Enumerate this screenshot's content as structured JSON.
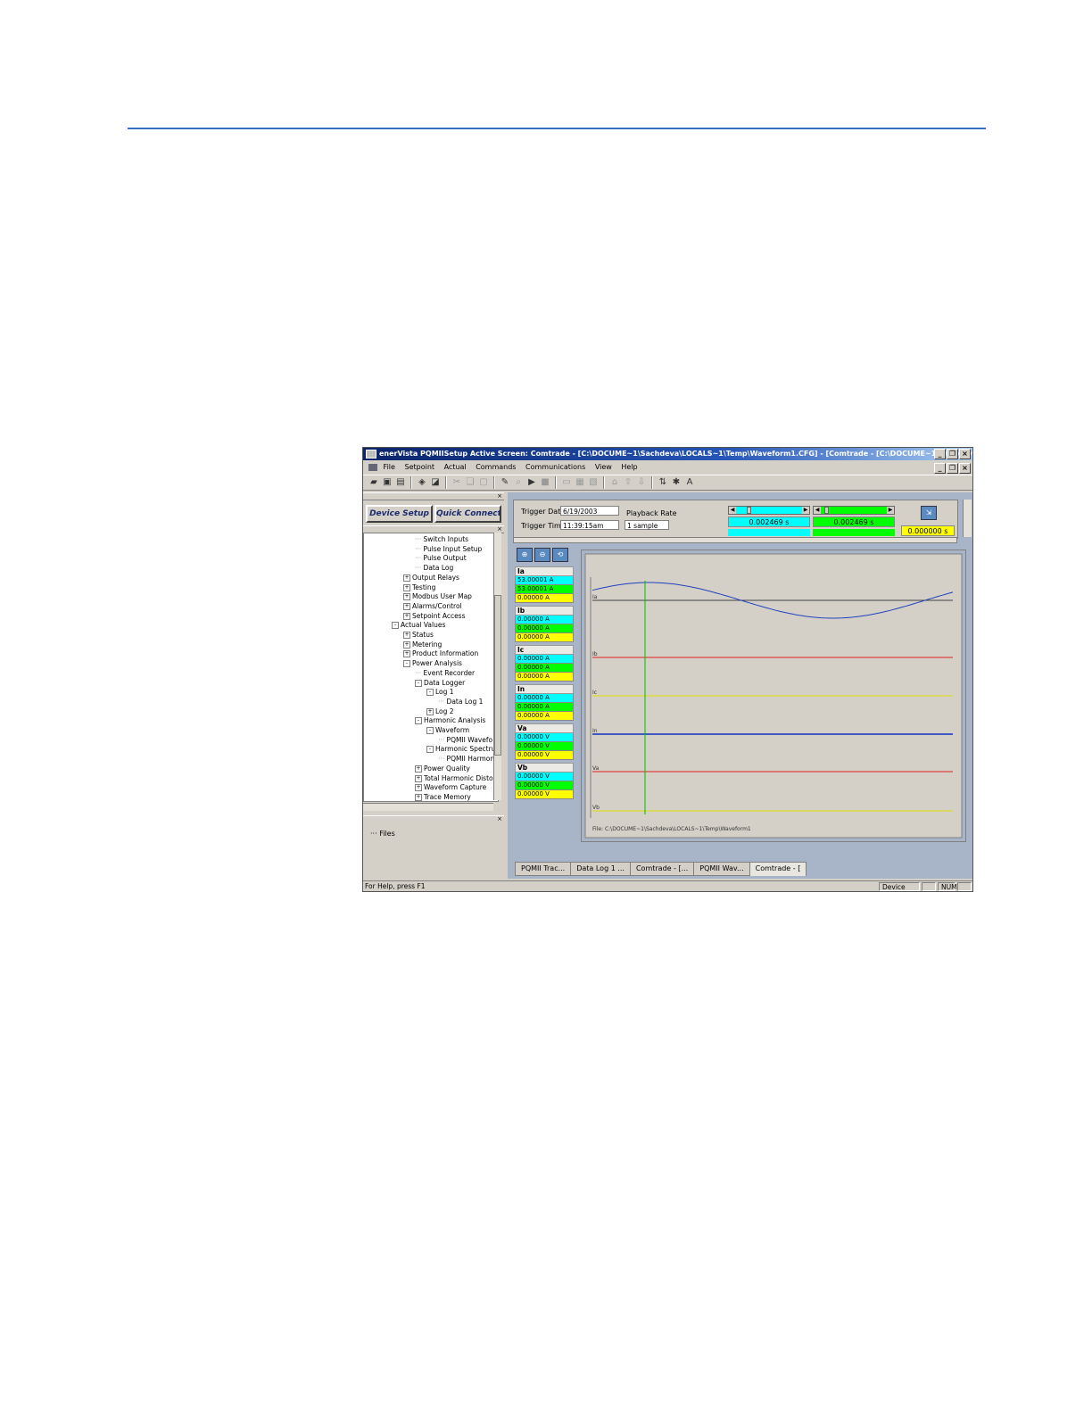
{
  "app": {
    "title": "enerVista PQMIISetup Active Screen: Comtrade - [C:\\DOCUME~1\\Sachdeva\\LOCALS~1\\Temp\\Waveform1.CFG] - [Comtrade - [C:\\DOCUME~1\\Sachdeva\\LOCALS~1\\Te..."
  },
  "menu": [
    "File",
    "Setpoint",
    "Actual",
    "Commands",
    "Communications",
    "View",
    "Help"
  ],
  "left": {
    "device_setup": "Device Setup",
    "quick_connect": "Quick Connect",
    "tree": [
      {
        "label": "Switch Inputs",
        "level": 3,
        "toggle": ""
      },
      {
        "label": "Pulse Input Setup",
        "level": 3,
        "toggle": ""
      },
      {
        "label": "Pulse Output",
        "level": 3,
        "toggle": ""
      },
      {
        "label": "Data Log",
        "level": 3,
        "toggle": ""
      },
      {
        "label": "Output Relays",
        "level": 2,
        "toggle": "+"
      },
      {
        "label": "Testing",
        "level": 2,
        "toggle": "+"
      },
      {
        "label": "Modbus User Map",
        "level": 2,
        "toggle": "+"
      },
      {
        "label": "Alarms/Control",
        "level": 2,
        "toggle": "+"
      },
      {
        "label": "Setpoint Access",
        "level": 2,
        "toggle": "+"
      },
      {
        "label": "Actual Values",
        "level": 1,
        "toggle": "-"
      },
      {
        "label": "Status",
        "level": 2,
        "toggle": "+"
      },
      {
        "label": "Metering",
        "level": 2,
        "toggle": "+"
      },
      {
        "label": "Product Information",
        "level": 2,
        "toggle": "+"
      },
      {
        "label": "Power Analysis",
        "level": 2,
        "toggle": "-"
      },
      {
        "label": "Event Recorder",
        "level": 3,
        "toggle": ""
      },
      {
        "label": "Data Logger",
        "level": 3,
        "toggle": "-"
      },
      {
        "label": "Log 1",
        "level": 4,
        "toggle": "-"
      },
      {
        "label": "Data Log 1",
        "level": 5,
        "toggle": ""
      },
      {
        "label": "Log 2",
        "level": 4,
        "toggle": "+"
      },
      {
        "label": "Harmonic Analysis",
        "level": 3,
        "toggle": "-"
      },
      {
        "label": "Waveform",
        "level": 4,
        "toggle": "-"
      },
      {
        "label": "PQMII Wavefo",
        "level": 5,
        "toggle": ""
      },
      {
        "label": "Harmonic Spectrur",
        "level": 4,
        "toggle": "-"
      },
      {
        "label": "PQMII Harmon",
        "level": 5,
        "toggle": ""
      },
      {
        "label": "Power Quality",
        "level": 3,
        "toggle": "+"
      },
      {
        "label": "Total Harmonic Distort",
        "level": 3,
        "toggle": "+"
      },
      {
        "label": "Waveform Capture",
        "level": 3,
        "toggle": "+"
      },
      {
        "label": "Trace Memory",
        "level": 3,
        "toggle": "+"
      }
    ],
    "files_label": "Files"
  },
  "trigger": {
    "date_label": "Trigger Date",
    "date_value": "6/19/2003",
    "time_label": "Trigger Time",
    "time_value": "11:39:15am",
    "playback_label": "Playback Rate",
    "playback_value": "1 sample",
    "cursor1_value": "0.002469 s",
    "cursor2_value": "0.002469 s",
    "delta_value": "0.000000 s",
    "cursor_color1": "#00ffff",
    "cursor_color2": "#00ff00",
    "delta_color": "#ffff00"
  },
  "channels": [
    {
      "name": "Ia",
      "values": [
        "53.00001 A",
        "53.00001 A",
        "0.00000 A"
      ]
    },
    {
      "name": "Ib",
      "values": [
        "0.00000 A",
        "0.00000 A",
        "0.00000 A"
      ]
    },
    {
      "name": "Ic",
      "values": [
        "0.00000 A",
        "0.00000 A",
        "0.00000 A"
      ]
    },
    {
      "name": "In",
      "values": [
        "0.00000 A",
        "0.00000 A",
        "0.00000 A"
      ]
    },
    {
      "name": "Va",
      "values": [
        "0.00000 V",
        "0.00000 V",
        "0.00000 V"
      ]
    },
    {
      "name": "Vb",
      "values": [
        "0.00000 V",
        "0.00000 V",
        "0.00000 V"
      ]
    }
  ],
  "plot": {
    "trace_labels": [
      "Ia",
      "Ib",
      "Ic",
      "In",
      "Va",
      "Vb"
    ],
    "trace_colors": [
      "#2040c0",
      "#e02020",
      "#e0e000",
      "#1030c0",
      "#e02020",
      "#e0e000"
    ],
    "file_text": "File: C:\\DOCUME~1\\Sachdeva\\LOCALS~1\\Temp\\Waveform1"
  },
  "tabs": [
    "PQMII Trac...",
    "Data Log 1 ...",
    "Comtrade - [...",
    "PQMII Wav...",
    "Comtrade - ["
  ],
  "status": {
    "help": "For Help, press F1",
    "mode": "Device Mode",
    "num": "NUM"
  }
}
